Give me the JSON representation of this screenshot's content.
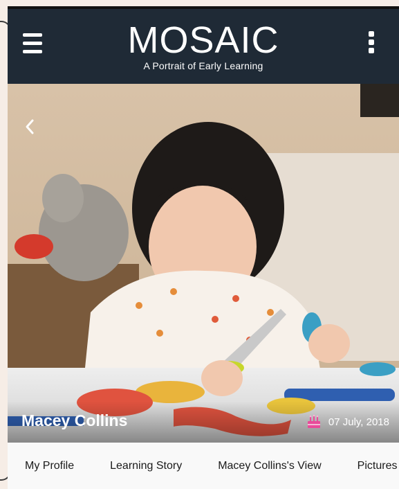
{
  "header": {
    "title": "MOSAIC",
    "subtitle": "A Portrait of Early Learning"
  },
  "profile": {
    "name": "Macey Collins",
    "birth_date": "07 July, 2018"
  },
  "tabs": [
    {
      "label": "My Profile"
    },
    {
      "label": "Learning Story"
    },
    {
      "label": "Macey Collins's View"
    },
    {
      "label": "Pictures"
    }
  ],
  "icons": {
    "menu": "hamburger-menu-icon",
    "more": "more-vertical-icon",
    "back": "chevron-left-icon",
    "birthday": "birthday-cake-icon"
  },
  "colors": {
    "appbar": "#1f2a36",
    "text_on_dark": "#ffffff",
    "birthday_icon": "#e84b9a"
  }
}
